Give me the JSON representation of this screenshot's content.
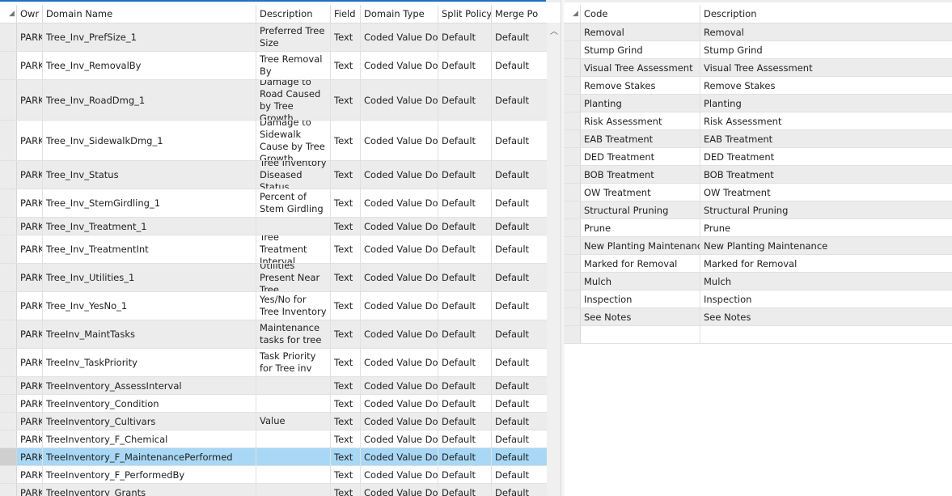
{
  "left_table": {
    "columns": [
      "Owr",
      "Domain Name",
      "Description",
      "Field ",
      "Domain Type",
      "Split Policy",
      "Merge Po"
    ],
    "rows": [
      {
        "owner": "PARK",
        "name": "Tree_Inv_PrefSize_1",
        "desc": "Preferred Tree Size",
        "field": "Text",
        "type": "Coded Value Don",
        "split": "Default",
        "merge": "Default"
      },
      {
        "owner": "PARK",
        "name": "Tree_Inv_RemovalBy",
        "desc": "Tree Removal By",
        "field": "Text",
        "type": "Coded Value Don",
        "split": "Default",
        "merge": "Default"
      },
      {
        "owner": "PARK",
        "name": "Tree_Inv_RoadDmg_1",
        "desc": "Damage to Road Caused by Tree Growth",
        "field": "Text",
        "type": "Coded Value Don",
        "split": "Default",
        "merge": "Default"
      },
      {
        "owner": "PARK",
        "name": "Tree_Inv_SidewalkDmg_1",
        "desc": "Damage to Sidewalk Cause by Tree Growth",
        "field": "Text",
        "type": "Coded Value Don",
        "split": "Default",
        "merge": "Default"
      },
      {
        "owner": "PARK",
        "name": "Tree_Inv_Status",
        "desc": "Tree Inventory Diseased Status",
        "field": "Text",
        "type": "Coded Value Don",
        "split": "Default",
        "merge": "Default"
      },
      {
        "owner": "PARK",
        "name": "Tree_Inv_StemGirdling_1",
        "desc": "Percent of Stem Girdling",
        "field": "Text",
        "type": "Coded Value Don",
        "split": "Default",
        "merge": "Default"
      },
      {
        "owner": "PARK",
        "name": "Tree_Inv_Treatment_1",
        "desc": "",
        "field": "Text",
        "type": "Coded Value Don",
        "split": "Default",
        "merge": "Default"
      },
      {
        "owner": "PARK",
        "name": "Tree_Inv_TreatmentInt",
        "desc": "Tree Treatment Interval",
        "field": "Text",
        "type": "Coded Value Don",
        "split": "Default",
        "merge": "Default"
      },
      {
        "owner": "PARK",
        "name": "Tree_Inv_Utilities_1",
        "desc": "Utilities Present Near Tree",
        "field": "Text",
        "type": "Coded Value Don",
        "split": "Default",
        "merge": "Default"
      },
      {
        "owner": "PARK",
        "name": "Tree_Inv_YesNo_1",
        "desc": "Yes/No for Tree Inventory",
        "field": "Text",
        "type": "Coded Value Don",
        "split": "Default",
        "merge": "Default"
      },
      {
        "owner": "PARK",
        "name": "TreeInv_MaintTasks",
        "desc": "Maintenance tasks for tree",
        "field": "Text",
        "type": "Coded Value Don",
        "split": "Default",
        "merge": "Default"
      },
      {
        "owner": "PARK",
        "name": "TreeInv_TaskPriority",
        "desc": "Task Priority for Tree inv",
        "field": "Text",
        "type": "Coded Value Don",
        "split": "Default",
        "merge": "Default"
      },
      {
        "owner": "PARK",
        "name": "TreeInventory_AssessInterval",
        "desc": "",
        "field": "Text",
        "type": "Coded Value Don",
        "split": "Default",
        "merge": "Default"
      },
      {
        "owner": "PARK",
        "name": "TreeInventory_Condition",
        "desc": "",
        "field": "Text",
        "type": "Coded Value Don",
        "split": "Default",
        "merge": "Default"
      },
      {
        "owner": "PARK",
        "name": "TreeInventory_Cultivars",
        "desc": "Value",
        "field": "Text",
        "type": "Coded Value Don",
        "split": "Default",
        "merge": "Default"
      },
      {
        "owner": "PARK",
        "name": "TreeInventory_F_Chemical",
        "desc": "",
        "field": "Text",
        "type": "Coded Value Don",
        "split": "Default",
        "merge": "Default"
      },
      {
        "owner": "PARK",
        "name": "TreeInventory_F_MaintenancePerformed",
        "desc": "",
        "field": "Text",
        "type": "Coded Value Don",
        "split": "Default",
        "merge": "Default"
      },
      {
        "owner": "PARK",
        "name": "TreeInventory_F_PerformedBy",
        "desc": "",
        "field": "Text",
        "type": "Coded Value Don",
        "split": "Default",
        "merge": "Default"
      },
      {
        "owner": "PARK",
        "name": "TreeInventory_Grants",
        "desc": "",
        "field": "Text",
        "type": "Coded Value Don",
        "split": "Default",
        "merge": "Default"
      }
    ],
    "selected_row_index": 16
  },
  "right_table": {
    "columns": [
      "Code",
      "Description"
    ],
    "rows": [
      {
        "code": "Removal",
        "desc": "Removal"
      },
      {
        "code": "Stump Grind",
        "desc": "Stump Grind"
      },
      {
        "code": "Visual Tree Assessment",
        "desc": "Visual Tree Assessment"
      },
      {
        "code": "Remove Stakes",
        "desc": "Remove Stakes"
      },
      {
        "code": "Planting",
        "desc": "Planting"
      },
      {
        "code": "Risk Assessment",
        "desc": "Risk Assessment"
      },
      {
        "code": "EAB Treatment",
        "desc": "EAB Treatment"
      },
      {
        "code": "DED Treatment",
        "desc": "DED Treatment"
      },
      {
        "code": "BOB Treatment",
        "desc": "BOB Treatment"
      },
      {
        "code": "OW Treatment",
        "desc": "OW Treatment"
      },
      {
        "code": "Structural Pruning",
        "desc": "Structural Pruning"
      },
      {
        "code": "Prune",
        "desc": "Prune"
      },
      {
        "code": "New Planting Maintenance",
        "desc": "New Planting Maintenance"
      },
      {
        "code": "Marked for Removal",
        "desc": "Marked for Removal"
      },
      {
        "code": "Mulch",
        "desc": "Mulch"
      },
      {
        "code": "Inspection",
        "desc": "Inspection"
      },
      {
        "code": "See Notes",
        "desc": "See Notes"
      },
      {
        "code": "",
        "desc": ""
      }
    ]
  },
  "colors": {
    "selected_row": "#a8d8f5",
    "alt_row": "#ececec",
    "accent": "#1a73c8"
  },
  "icons": {
    "sort": "sort-corner-icon",
    "scroll_up": "scroll-up-arrow-icon"
  }
}
